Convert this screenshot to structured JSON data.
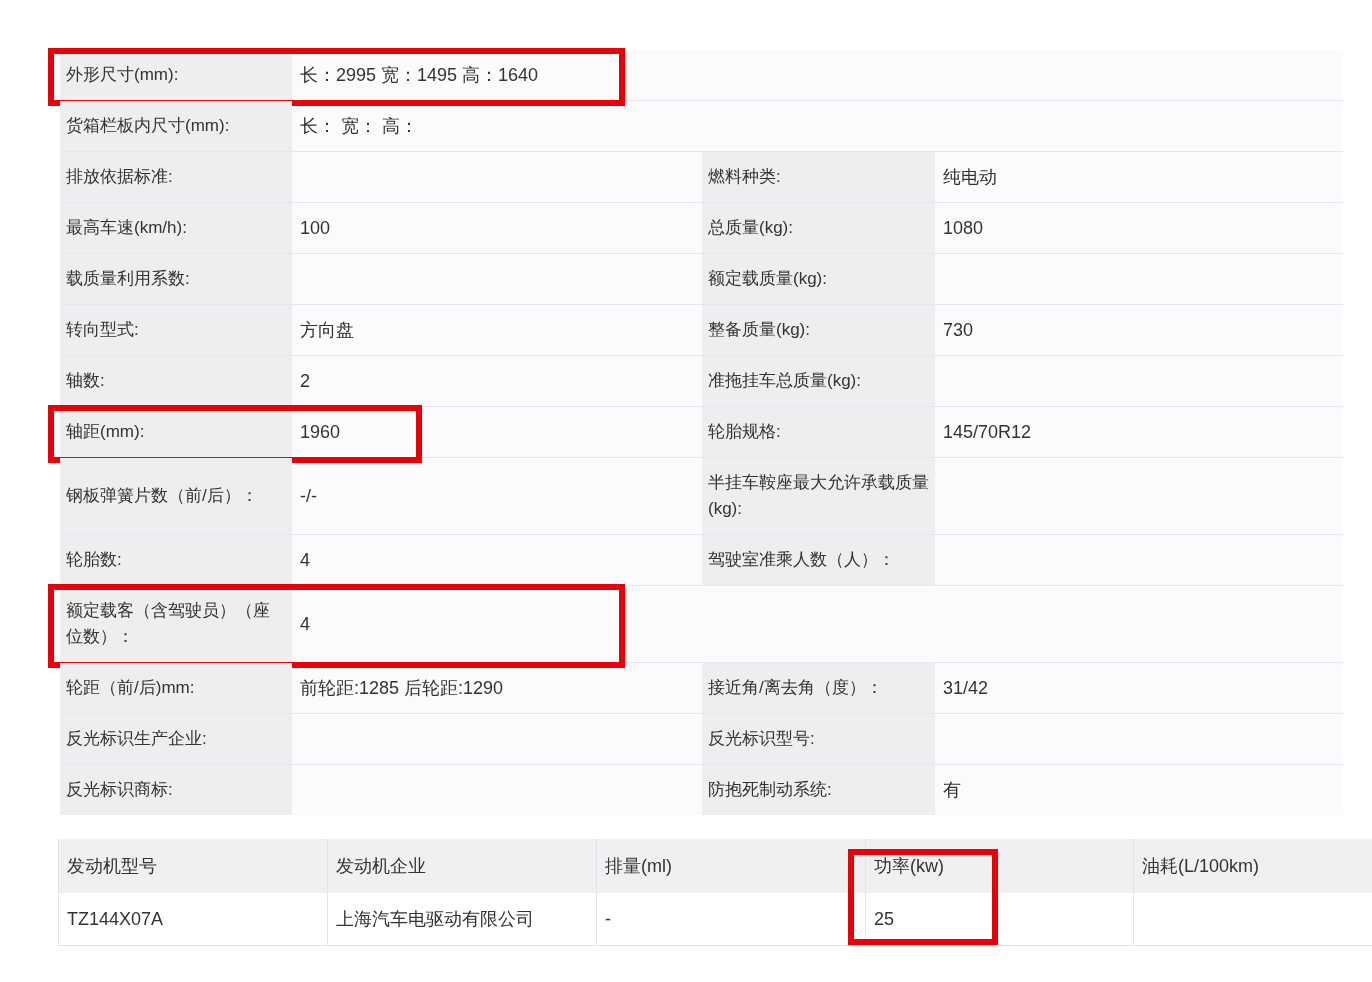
{
  "specs": [
    {
      "kind": "wide",
      "highlighted": true,
      "cells": [
        {
          "label": "外形尺寸(mm):",
          "value": "长：2995 宽：1495 高：1640"
        }
      ]
    },
    {
      "kind": "wide",
      "highlighted": false,
      "cells": [
        {
          "label": "货箱栏板内尺寸(mm):",
          "value": "长：  宽：  高："
        }
      ]
    },
    {
      "kind": "pair",
      "highlighted": false,
      "cells": [
        {
          "label": "排放依据标准:"
        },
        {
          "label": "燃料种类:",
          "value": "纯电动"
        }
      ]
    },
    {
      "kind": "pair",
      "highlighted": false,
      "cells": [
        {
          "label": "最高车速(km/h):",
          "value": "100"
        },
        {
          "label": "总质量(kg):",
          "value": "1080"
        }
      ]
    },
    {
      "kind": "pair",
      "highlighted": false,
      "cells": [
        {
          "label": "载质量利用系数:"
        },
        {
          "label": "额定载质量(kg):"
        }
      ]
    },
    {
      "kind": "pair",
      "highlighted": false,
      "cells": [
        {
          "label": "转向型式:",
          "value": "方向盘"
        },
        {
          "label": "整备质量(kg):",
          "value": "730"
        }
      ]
    },
    {
      "kind": "pair",
      "highlighted": false,
      "cells": [
        {
          "label": "轴数:",
          "value": "2"
        },
        {
          "label": "准拖挂车总质量(kg):"
        }
      ]
    },
    {
      "kind": "pair",
      "highlighted": true,
      "cells": [
        {
          "label": "轴距(mm):",
          "value": "1960"
        },
        {
          "label": "轮胎规格:",
          "value": "145/70R12"
        }
      ]
    },
    {
      "kind": "pair",
      "highlighted": false,
      "cells": [
        {
          "label": "钢板弹簧片数（前/后）：",
          "value": "-/-"
        },
        {
          "label": "半挂车鞍座最大允许承载质量(kg):"
        }
      ]
    },
    {
      "kind": "pair",
      "highlighted": false,
      "cells": [
        {
          "label": "轮胎数:",
          "value": "4"
        },
        {
          "label": "驾驶室准乘人数（人）："
        }
      ]
    },
    {
      "kind": "wide",
      "highlighted": true,
      "cells": [
        {
          "label": "额定载客（含驾驶员）（座位数）：",
          "value": "4"
        }
      ]
    },
    {
      "kind": "pair",
      "highlighted": false,
      "cells": [
        {
          "label": "轮距（前/后)mm:",
          "value": "前轮距:1285 后轮距:1290"
        },
        {
          "label": "接近角/离去角（度）：",
          "value": "31/42"
        }
      ]
    },
    {
      "kind": "pair",
      "highlighted": false,
      "cells": [
        {
          "label": "反光标识生产企业:"
        },
        {
          "label": "反光标识型号:"
        }
      ]
    },
    {
      "kind": "pair",
      "highlighted": false,
      "cells": [
        {
          "label": "反光标识商标:"
        },
        {
          "label": "防抱死制动系统:",
          "value": "有"
        }
      ]
    }
  ],
  "engine_table": {
    "columns": [
      {
        "header": "发动机型号",
        "highlighted": false
      },
      {
        "header": "发动机企业",
        "highlighted": false
      },
      {
        "header": "排量(ml)",
        "highlighted": false
      },
      {
        "header": "功率(kw)",
        "highlighted": true
      },
      {
        "header": "油耗(L/100km)",
        "highlighted": false
      }
    ],
    "rows": [
      [
        "TZ144X07A",
        "上海汽车电驱动有限公司",
        "-",
        "25"
      ]
    ]
  }
}
